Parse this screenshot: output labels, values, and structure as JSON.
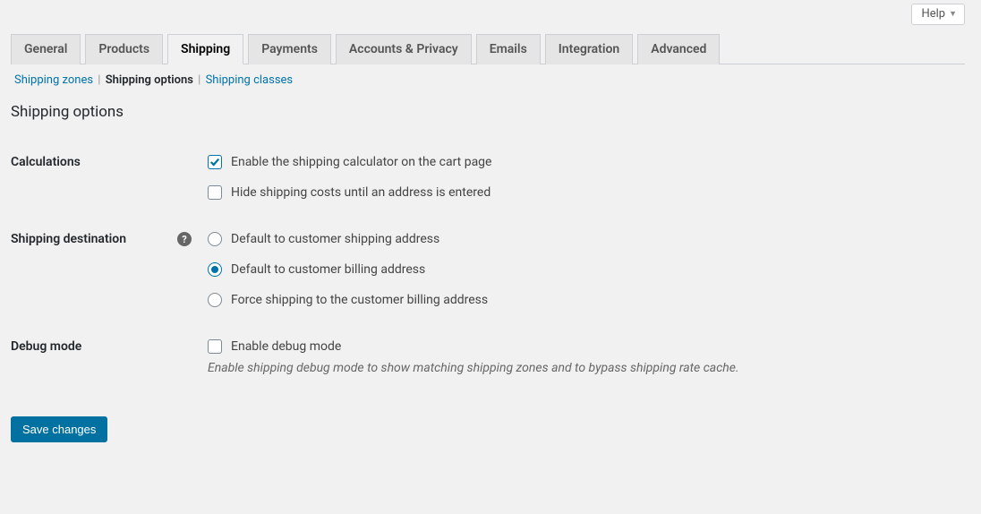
{
  "help_button": "Help",
  "tabs": {
    "general": "General",
    "products": "Products",
    "shipping": "Shipping",
    "payments": "Payments",
    "accounts": "Accounts & Privacy",
    "emails": "Emails",
    "integration": "Integration",
    "advanced": "Advanced"
  },
  "subnav": {
    "zones": "Shipping zones",
    "options": "Shipping options",
    "classes": "Shipping classes"
  },
  "section_title": "Shipping options",
  "calculations": {
    "label": "Calculations",
    "enable_calculator": "Enable the shipping calculator on the cart page",
    "hide_costs": "Hide shipping costs until an address is entered"
  },
  "destination": {
    "label": "Shipping destination",
    "opt_shipping": "Default to customer shipping address",
    "opt_billing": "Default to customer billing address",
    "opt_force": "Force shipping to the customer billing address"
  },
  "debug": {
    "label": "Debug mode",
    "enable": "Enable debug mode",
    "description": "Enable shipping debug mode to show matching shipping zones and to bypass shipping rate cache."
  },
  "save_button": "Save changes"
}
